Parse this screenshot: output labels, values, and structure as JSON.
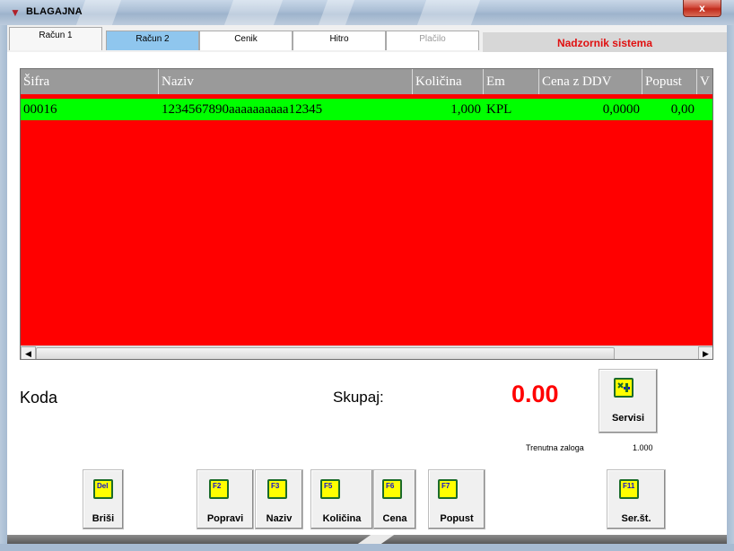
{
  "window": {
    "title": "BLAGAJNA",
    "close_label": "x"
  },
  "tabs": [
    {
      "label": "Račun 1"
    },
    {
      "label": "Račun 2"
    },
    {
      "label": "Cenik"
    },
    {
      "label": "Hitro"
    },
    {
      "label": "Plačilo"
    }
  ],
  "header_user": "Nadzornik sistema",
  "grid": {
    "columns": [
      "Šifra",
      "Naziv",
      "Količina",
      "Em",
      "Cena z DDV",
      "Popust",
      "V"
    ],
    "rows": [
      {
        "sifra": "00016",
        "naziv": "1234567890aaaaaaaaaa12345",
        "kolicina": "1,000",
        "em": "KPL",
        "cena": "0,0000",
        "popust": "0,00"
      }
    ],
    "colors": {
      "background": "#ff0000",
      "selected_row": "#00ff00",
      "header": "#9a9a9a"
    }
  },
  "panel": {
    "code_label": "Koda",
    "total_label": "Skupaj:",
    "total_value": "0.00",
    "stock_label": "Trenutna zaloga",
    "stock_value": "1.000"
  },
  "buttons": {
    "servisi": {
      "key": "",
      "label": "Servisi",
      "icon": "tools-icon"
    },
    "brisi": {
      "key": "Del",
      "label": "Briši"
    },
    "popravi": {
      "key": "F2",
      "label": "Popravi"
    },
    "naziv": {
      "key": "F3",
      "label": "Naziv"
    },
    "kolicina": {
      "key": "F5",
      "label": "Količina"
    },
    "cena": {
      "key": "F6",
      "label": "Cena"
    },
    "popust": {
      "key": "F7",
      "label": "Popust"
    },
    "serst": {
      "key": "F11",
      "label": "Ser.št."
    }
  }
}
